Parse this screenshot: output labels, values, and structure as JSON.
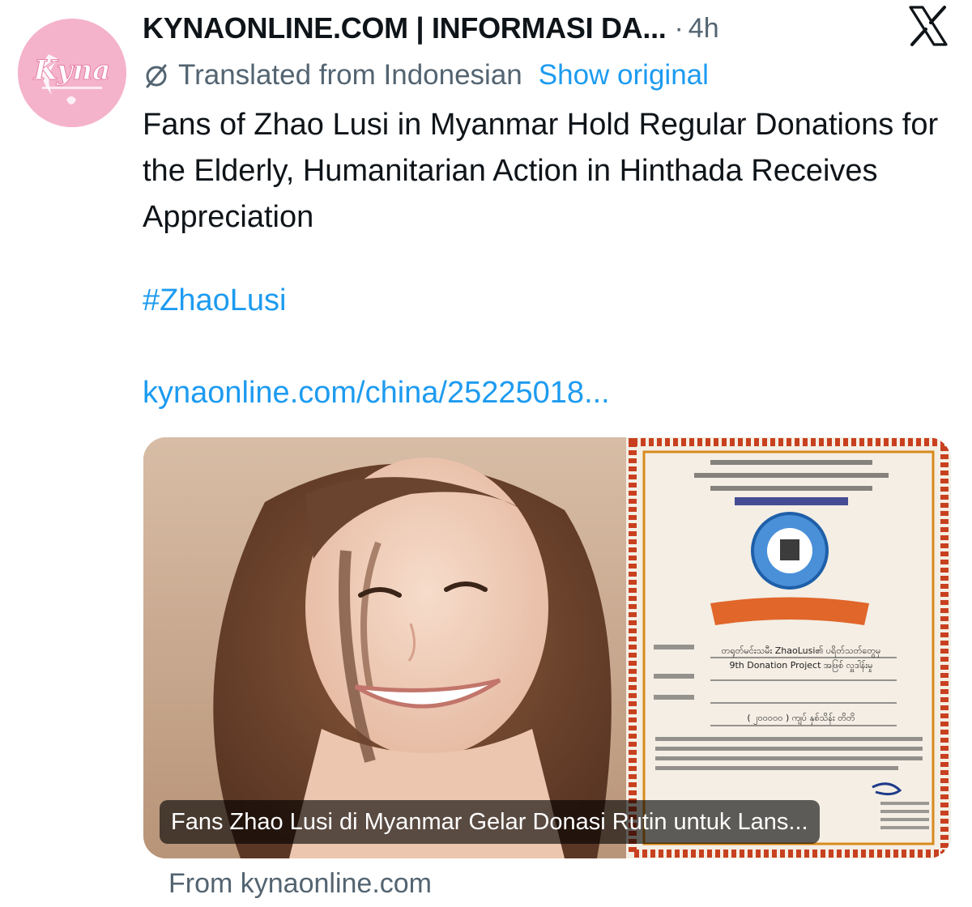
{
  "author": {
    "display_name": "KYNAONLINE.COM | INFORMASI DA...",
    "avatar_logo_text": "Kyna",
    "timestamp": "4h"
  },
  "translation": {
    "label": "Translated from Indonesian",
    "show_original": "Show original"
  },
  "tweet": {
    "text": "Fans of Zhao Lusi in Myanmar Hold Regular Donations for the Elderly, Humanitarian Action in Hinthada Receives Appreciation",
    "hashtag": "#ZhaoLusi",
    "link": "kynaonline.com/china/25225018..."
  },
  "card": {
    "caption": "Fans Zhao Lusi di Myanmar Gelar Donasi Rutin untuk Lans...",
    "source": "From kynaonline.com",
    "certificate_lines": {
      "name_line": "တရုတ်မင်းသမီး ZhaoLusi၏ ပရိတ်သတ်တွေမှ",
      "project_line": "9th Donation Project အဖြစ် လှူဒါန်းမှု",
      "amount_line": "( ၂၀၀၀၀၀ ) ကျပ် နှစ်သိန်း တိတိ"
    }
  },
  "icons": {
    "brand": "x-logo-icon",
    "translate": "translate-icon"
  },
  "colors": {
    "link_blue": "#1d9bf0",
    "secondary_gray": "#536471",
    "text_dark": "#0f1419",
    "avatar_pink": "#f2a9c4",
    "certificate_border": "#c8401f"
  }
}
